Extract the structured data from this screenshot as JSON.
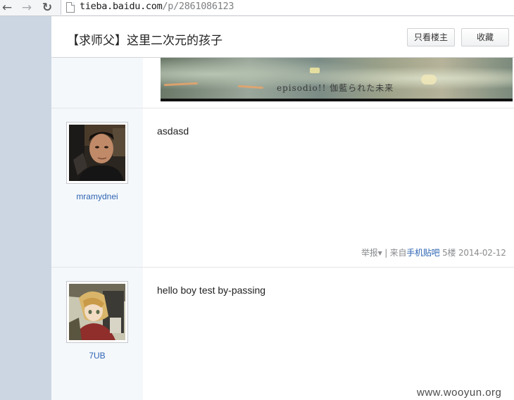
{
  "browser": {
    "back_icon": "arrow-left-icon",
    "forward_icon": "arrow-right-icon",
    "reload_icon": "reload-icon",
    "page_icon": "document-icon",
    "url_host": "tieba.baidu.com",
    "url_path": "/p/2861086123"
  },
  "header": {
    "title": "【求师父】这里二次元的孩子",
    "only_op_label": "只看楼主",
    "favorite_label": "收藏"
  },
  "banner": {
    "caption": "episodio!! 伽藍られた未来"
  },
  "posts": [
    {
      "username": "mramydnei",
      "text": "asdasd",
      "report_label": "举报",
      "from_label": "| 来自",
      "client_label": "手机贴吧",
      "floor": "5楼",
      "date": "2014-02-12"
    },
    {
      "username": "7UB",
      "text": "hello boy test by-passing"
    }
  ],
  "watermark": "www.wooyun.org",
  "colors": {
    "sidebar_bg": "#cbd6e2",
    "link_blue": "#2d64b3",
    "author_col_bg": "#f5f8fb"
  }
}
